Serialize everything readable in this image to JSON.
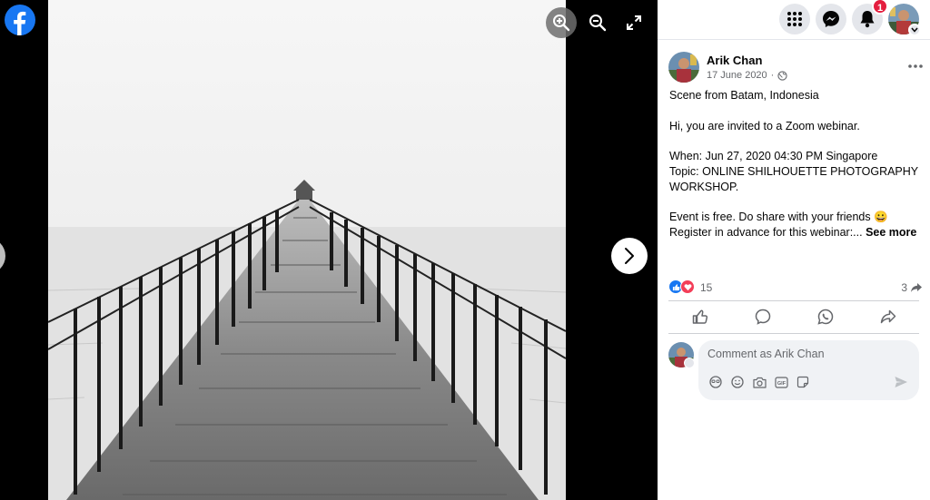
{
  "viewer": {
    "icons": [
      "facebook-logo",
      "zoom-in-icon",
      "zoom-out-icon",
      "fullscreen-icon",
      "chevron-right-icon",
      "chevron-left-icon"
    ]
  },
  "topbar": {
    "notifications_count": "1",
    "icons": [
      "menu-grid-icon",
      "messenger-icon",
      "bell-icon",
      "profile-avatar"
    ]
  },
  "post": {
    "author": "Arik Chan",
    "date": "17 June 2020",
    "privacy_icon": "globe-icon",
    "body_lines": [
      "Scene from Batam, Indonesia",
      "",
      "Hi, you are invited to a Zoom webinar.",
      "",
      "When: Jun 27, 2020 04:30 PM Singapore",
      "Topic: ONLINE SHILHOUETTE PHOTOGRAPHY WORKSHOP.",
      "",
      "Event is free. Do share with your friends 😀"
    ],
    "last_line": "Register in advance for this webinar:...",
    "see_more": "See more"
  },
  "reactions": {
    "count": "15",
    "types": [
      "like",
      "love"
    ],
    "shares": "3"
  },
  "actions": [
    "like-action",
    "comment-action",
    "whatsapp-action",
    "share-action"
  ],
  "comment": {
    "placeholder": "Comment as Arik Chan",
    "tools": [
      "avatar-sticker-icon",
      "emoji-icon",
      "camera-icon",
      "gif-icon",
      "sticker-icon"
    ]
  },
  "colors": {
    "brand": "#1877f2",
    "badge": "#e41e3f",
    "text_secondary": "#65676b"
  }
}
